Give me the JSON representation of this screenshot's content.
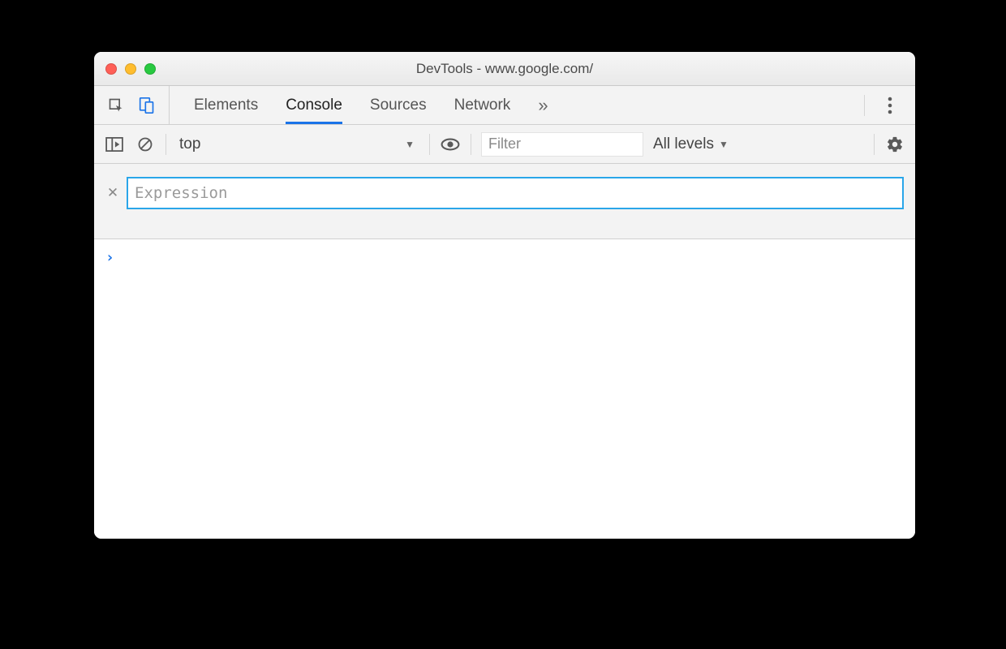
{
  "window": {
    "title": "DevTools - www.google.com/"
  },
  "tabs": {
    "items": [
      "Elements",
      "Console",
      "Sources",
      "Network"
    ],
    "active": "Console"
  },
  "toolbar": {
    "context": "top",
    "filter_placeholder": "Filter",
    "levels_label": "All levels"
  },
  "live_expression": {
    "placeholder": "Expression",
    "value": ""
  },
  "console": {
    "prompt": "›"
  }
}
